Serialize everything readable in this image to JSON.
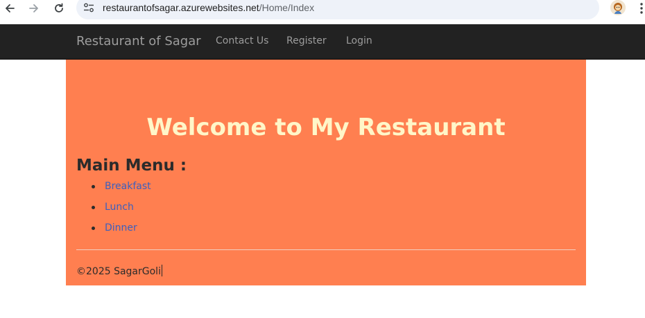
{
  "browser": {
    "url_host": "restaurantofsagar.azurewebsites.net",
    "url_path": "/Home/Index",
    "back_icon": "arrow-left-icon",
    "forward_icon": "arrow-right-icon",
    "reload_icon": "reload-icon",
    "site_info_icon": "tune-icon",
    "bookmark_icon": "star-icon",
    "profile_icon": "avatar-icon",
    "menu_icon": "kebab-menu-icon"
  },
  "navbar": {
    "brand": "Restaurant of Sagar",
    "links": [
      "Contact Us",
      "Register",
      "Login"
    ]
  },
  "main": {
    "welcome": "Welcome to My Restaurant",
    "menu_heading": "Main Menu :",
    "menu_items": [
      "Breakfast",
      "Lunch",
      "Dinner"
    ]
  },
  "footer": {
    "text": "©2025 SagarGoli"
  },
  "colors": {
    "navbar_bg": "#222222",
    "panel_bg": "#ff7f50",
    "welcome_text": "#fff6c8",
    "link": "#3b5fbf"
  }
}
